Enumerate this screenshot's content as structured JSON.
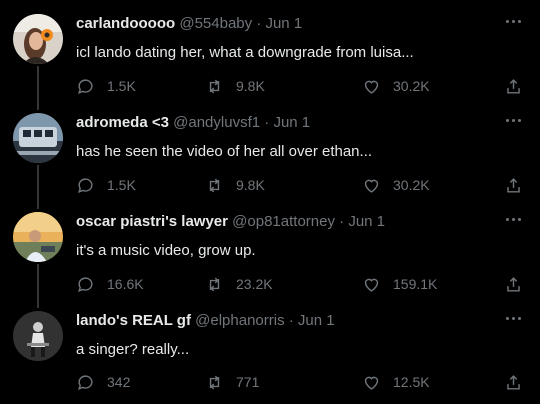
{
  "tweets": [
    {
      "name": "carlandooooo",
      "handle": "@554baby",
      "date": "Jun 1",
      "text": "icl lando dating her, what a downgrade from luisa...",
      "replies": "1.5K",
      "retweets": "9.8K",
      "likes": "30.2K"
    },
    {
      "name": "adromeda <3",
      "handle": "@andyluvsf1",
      "date": "Jun 1",
      "text": "has he seen the video of her all over ethan...",
      "replies": "1.5K",
      "retweets": "9.8K",
      "likes": "30.2K"
    },
    {
      "name": "oscar piastri's lawyer",
      "handle": "@op81attorney",
      "date": "Jun 1",
      "text": "it's a music video, grow up.",
      "replies": "16.6K",
      "retweets": "23.2K",
      "likes": "159.1K"
    },
    {
      "name": "lando's REAL gf",
      "handle": "@elphanorris",
      "date": "Jun 1",
      "text": "a singer? really...",
      "replies": "342",
      "retweets": "771",
      "likes": "12.5K"
    }
  ],
  "colors": {
    "background": "#000000",
    "text": "#e7e9ea",
    "muted": "#71767b",
    "line": "#333639"
  }
}
